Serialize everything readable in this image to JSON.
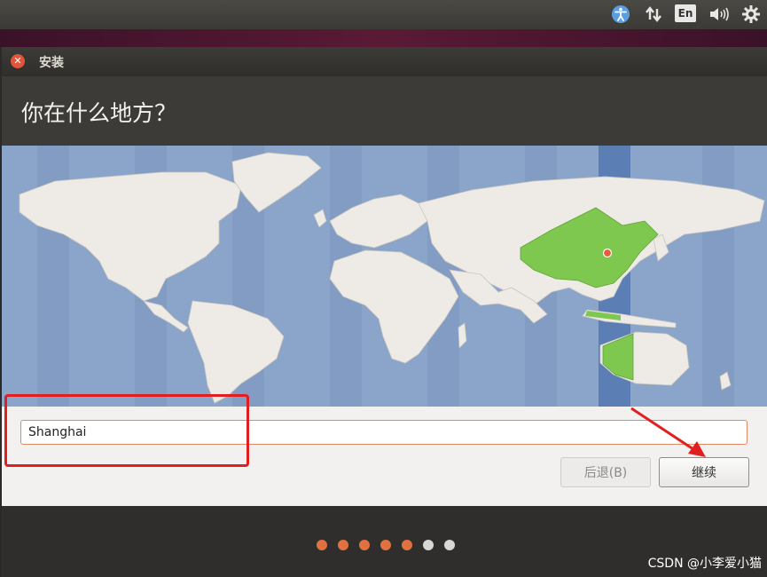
{
  "top_panel": {
    "indicators": [
      {
        "icon": "accessibility-icon"
      },
      {
        "icon": "network-arrows-icon"
      },
      {
        "icon": "keyboard-layout-icon",
        "label": "En"
      },
      {
        "icon": "volume-icon"
      },
      {
        "icon": "gear-icon"
      }
    ]
  },
  "window": {
    "title": "安装",
    "close_icon": "close-icon",
    "heading": "你在什么地方？",
    "map": {
      "selected_region_color": "#7ec850",
      "timezone_band_color": "#5b7fb5",
      "ocean_color": "#8ba4c9",
      "land_color": "#eeebe6"
    },
    "location": {
      "value": "Shanghai"
    },
    "buttons": {
      "back": "后退(B)",
      "next": "继续"
    },
    "progress_steps": {
      "total": 7,
      "completed": 5,
      "accent_color": "#e07242"
    }
  },
  "watermark": "CSDN @小李爱小猫"
}
